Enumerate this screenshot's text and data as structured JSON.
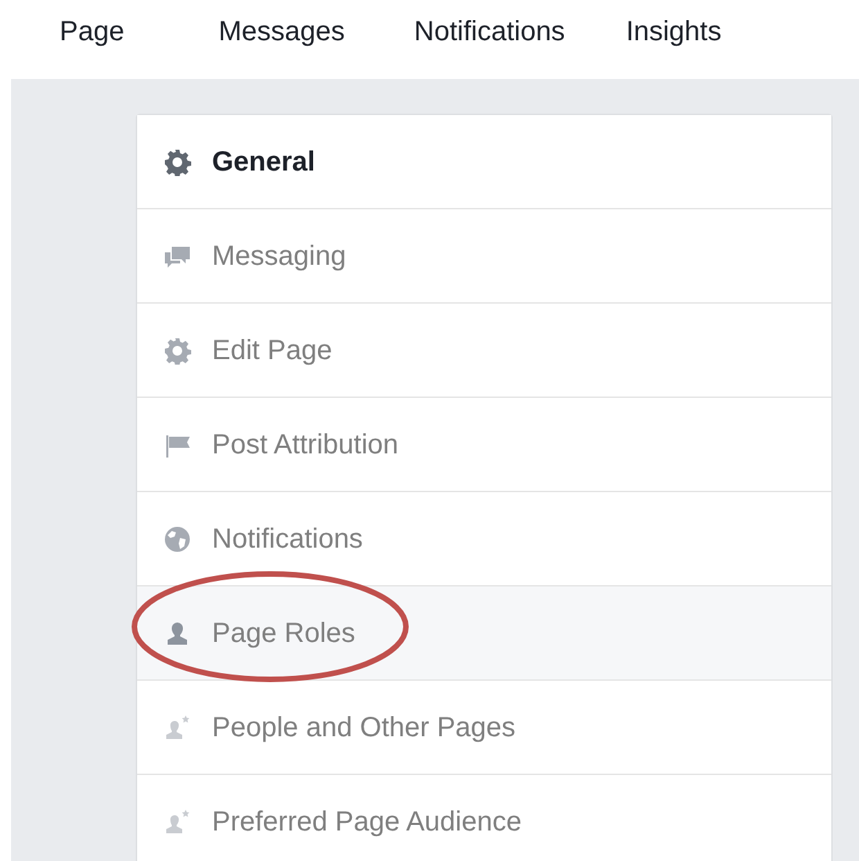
{
  "nav_tabs": [
    {
      "label": "Page"
    },
    {
      "label": "Messages"
    },
    {
      "label": "Notifications"
    },
    {
      "label": "Insights"
    }
  ],
  "settings_menu": [
    {
      "label": "General",
      "kind": "header",
      "selected": false,
      "circled": false
    },
    {
      "label": "Messaging",
      "kind": "item",
      "selected": false,
      "circled": false
    },
    {
      "label": "Edit Page",
      "kind": "item",
      "selected": false,
      "circled": false
    },
    {
      "label": "Post Attribution",
      "kind": "item",
      "selected": false,
      "circled": false
    },
    {
      "label": "Notifications",
      "kind": "item",
      "selected": false,
      "circled": false
    },
    {
      "label": "Page Roles",
      "kind": "item",
      "selected": true,
      "circled": true
    },
    {
      "label": "People and Other Pages",
      "kind": "item",
      "selected": false,
      "circled": false
    },
    {
      "label": "Preferred Page Audience",
      "kind": "item",
      "selected": false,
      "circled": false
    }
  ]
}
